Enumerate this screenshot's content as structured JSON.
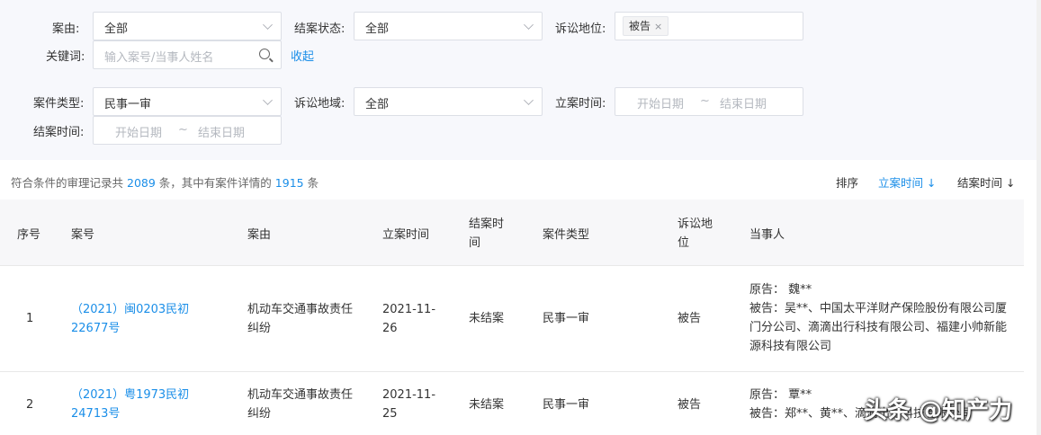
{
  "filters": {
    "cause_label": "案由:",
    "cause_value": "全部",
    "status_label": "结案状态:",
    "status_value": "全部",
    "position_label": "诉讼地位:",
    "position_tag": "被告",
    "position_tag_close": "×",
    "keyword_label": "关键词:",
    "keyword_placeholder": "输入案号/当事人姓名",
    "collapse_label": "收起",
    "case_type_label": "案件类型:",
    "case_type_value": "民事一审",
    "region_label": "诉讼地域:",
    "region_value": "全部",
    "filing_time_label": "立案时间:",
    "close_time_label": "结案时间:",
    "date_start_placeholder": "开始日期",
    "date_sep": "~",
    "date_end_placeholder": "结束日期"
  },
  "summary": {
    "prefix": "符合条件的审理记录共",
    "total": "2089",
    "middle": "条，其中有案件详情的",
    "detailed": "1915",
    "suffix": "条"
  },
  "sort": {
    "label": "排序",
    "option1": "立案时间 ↓",
    "option2": "结案时间 ↓"
  },
  "table": {
    "headers": {
      "index": "序号",
      "case_no": "案号",
      "cause": "案由",
      "filing_time": "立案时间",
      "close_time": "结案时间",
      "case_type": "案件类型",
      "position": "诉讼地位",
      "parties": "当事人"
    },
    "rows": [
      {
        "index": "1",
        "case_no": "（2021）闽0203民初22677号",
        "cause": "机动车交通事故责任纠纷",
        "filing_time": "2021-11-26",
        "close_time": "未结案",
        "case_type": "民事一审",
        "position": "被告",
        "plaintiff": "原告： 魏**",
        "defendant": "被告：吴**、中国太平洋财产保险股份有限公司厦门分公司、滴滴出行科技有限公司、福建小帅新能源科技有限公司"
      },
      {
        "index": "2",
        "case_no": "（2021）粤1973民初24713号",
        "cause": "机动车交通事故责任纠纷",
        "filing_time": "2021-11-25",
        "close_time": "未结案",
        "case_type": "民事一审",
        "position": "被告",
        "plaintiff": "原告： 覃**",
        "defendant": "被告：郑**、黄**、滴滴出行科技有限公司"
      }
    ]
  },
  "watermark": "头条 @知产力"
}
